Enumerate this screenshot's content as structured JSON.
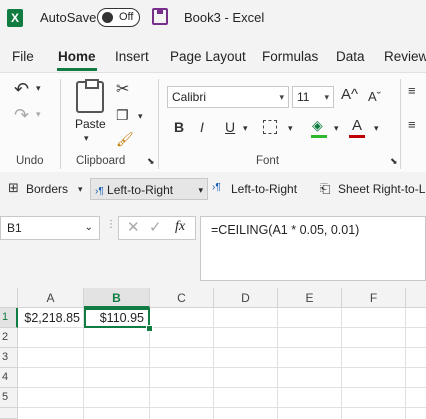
{
  "titlebar": {
    "autosave_label": "AutoSave",
    "autosave_state": "Off",
    "doc_title": "Book3  -  Excel"
  },
  "tabs": [
    {
      "label": "File"
    },
    {
      "label": "Home"
    },
    {
      "label": "Insert"
    },
    {
      "label": "Page Layout"
    },
    {
      "label": "Formulas"
    },
    {
      "label": "Data"
    },
    {
      "label": "Review"
    }
  ],
  "ribbon": {
    "undo_label": "Undo",
    "clipboard_label": "Clipboard",
    "paste_label": "Paste",
    "font_label": "Font",
    "font_name": "Calibri",
    "font_size": "11"
  },
  "qat": {
    "borders": "Borders",
    "ltr1": "Left-to-Right",
    "ltr2": "Left-to-Right",
    "sheet_rtl": "Sheet Right-to-L"
  },
  "formula_bar": {
    "name_box": "B1",
    "fx": "fx",
    "formula": "=CEILING(A1 * 0.05, 0.01)"
  },
  "grid": {
    "columns": [
      "A",
      "B",
      "C",
      "D",
      "E",
      "F"
    ],
    "rows": [
      "1",
      "2",
      "3",
      "4",
      "5"
    ],
    "cells": {
      "A1": "$2,218.85",
      "B1": "$110.95"
    }
  },
  "colors": {
    "accent": "#107c41",
    "save": "#7a2e8c"
  }
}
